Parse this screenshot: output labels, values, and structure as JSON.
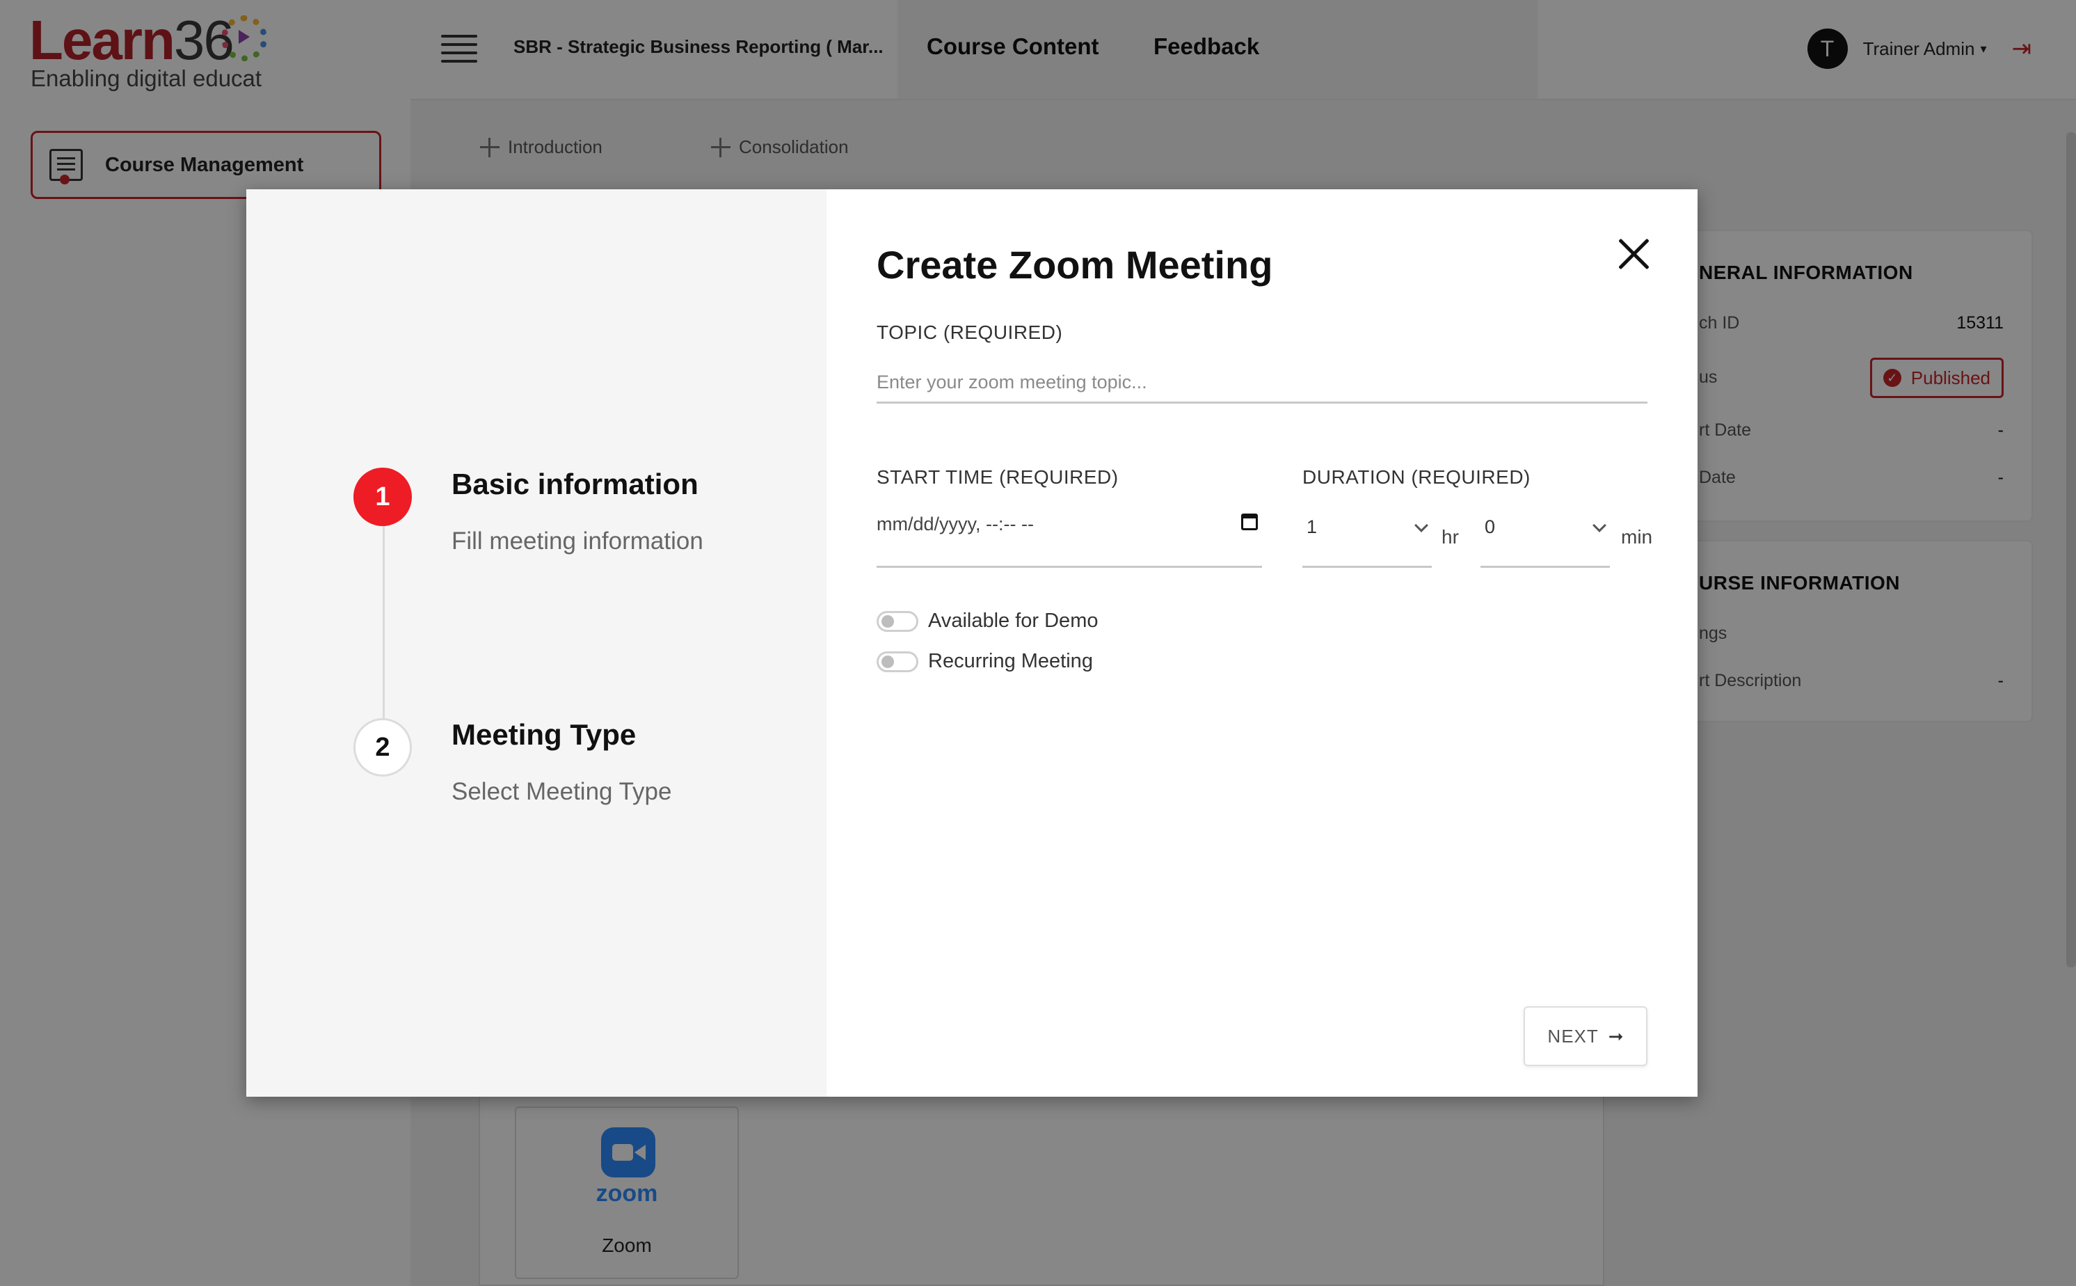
{
  "brand": {
    "name_text": "Learn",
    "name_number": "36",
    "tagline": "Enabling digital educat"
  },
  "sidebar": {
    "course_management_label": "Course Management"
  },
  "topbar": {
    "course_title": "SBR - Strategic Business Reporting ( Mar...",
    "nav_course_content": "Course Content",
    "nav_feedback": "Feedback",
    "user_initial": "T",
    "user_name": "Trainer Admin",
    "caret": "▾",
    "logout_icon": "⇥"
  },
  "subnav": {
    "items": [
      "Introduction",
      "Consolidation"
    ]
  },
  "content": {
    "zoom_logo_text": "zoom",
    "zoom_card_label": "Zoom"
  },
  "general_info": {
    "title": "NERAL INFORMATION",
    "rows": [
      {
        "key": "ch ID",
        "value": "15311"
      },
      {
        "key": "us",
        "value": ""
      },
      {
        "key": "rt Date",
        "value": "-"
      },
      {
        "key": "Date",
        "value": "-"
      }
    ],
    "status_badge": "Published",
    "status_icon": "✓"
  },
  "course_info": {
    "title": "URSE INFORMATION",
    "rows": [
      {
        "key": "ngs",
        "value": ""
      },
      {
        "key": "rt Description",
        "value": "-"
      }
    ]
  },
  "modal": {
    "title": "Create Zoom Meeting",
    "steps": [
      {
        "number": "1",
        "title": "Basic information",
        "subtitle": "Fill meeting information",
        "active": true
      },
      {
        "number": "2",
        "title": "Meeting Type",
        "subtitle": "Select Meeting Type",
        "active": false
      }
    ],
    "topic_label": "TOPIC (REQUIRED)",
    "topic_placeholder": "Enter your zoom meeting topic...",
    "topic_value": "",
    "start_time_label": "START TIME (REQUIRED)",
    "start_time_placeholder": "mm/dd/yyyy, --:-- --",
    "duration_label": "DURATION (REQUIRED)",
    "duration_hours": "1",
    "duration_hours_unit": "hr",
    "duration_minutes": "0",
    "duration_minutes_unit": "min",
    "toggle_demo_label": "Available for Demo",
    "toggle_demo_on": false,
    "toggle_recurring_label": "Recurring Meeting",
    "toggle_recurring_on": false,
    "next_label": "NEXT",
    "next_arrow": "➞"
  },
  "colors": {
    "brand_red": "#c7242d",
    "step_active": "#ee1c25",
    "zoom_blue": "#2d8cff"
  }
}
